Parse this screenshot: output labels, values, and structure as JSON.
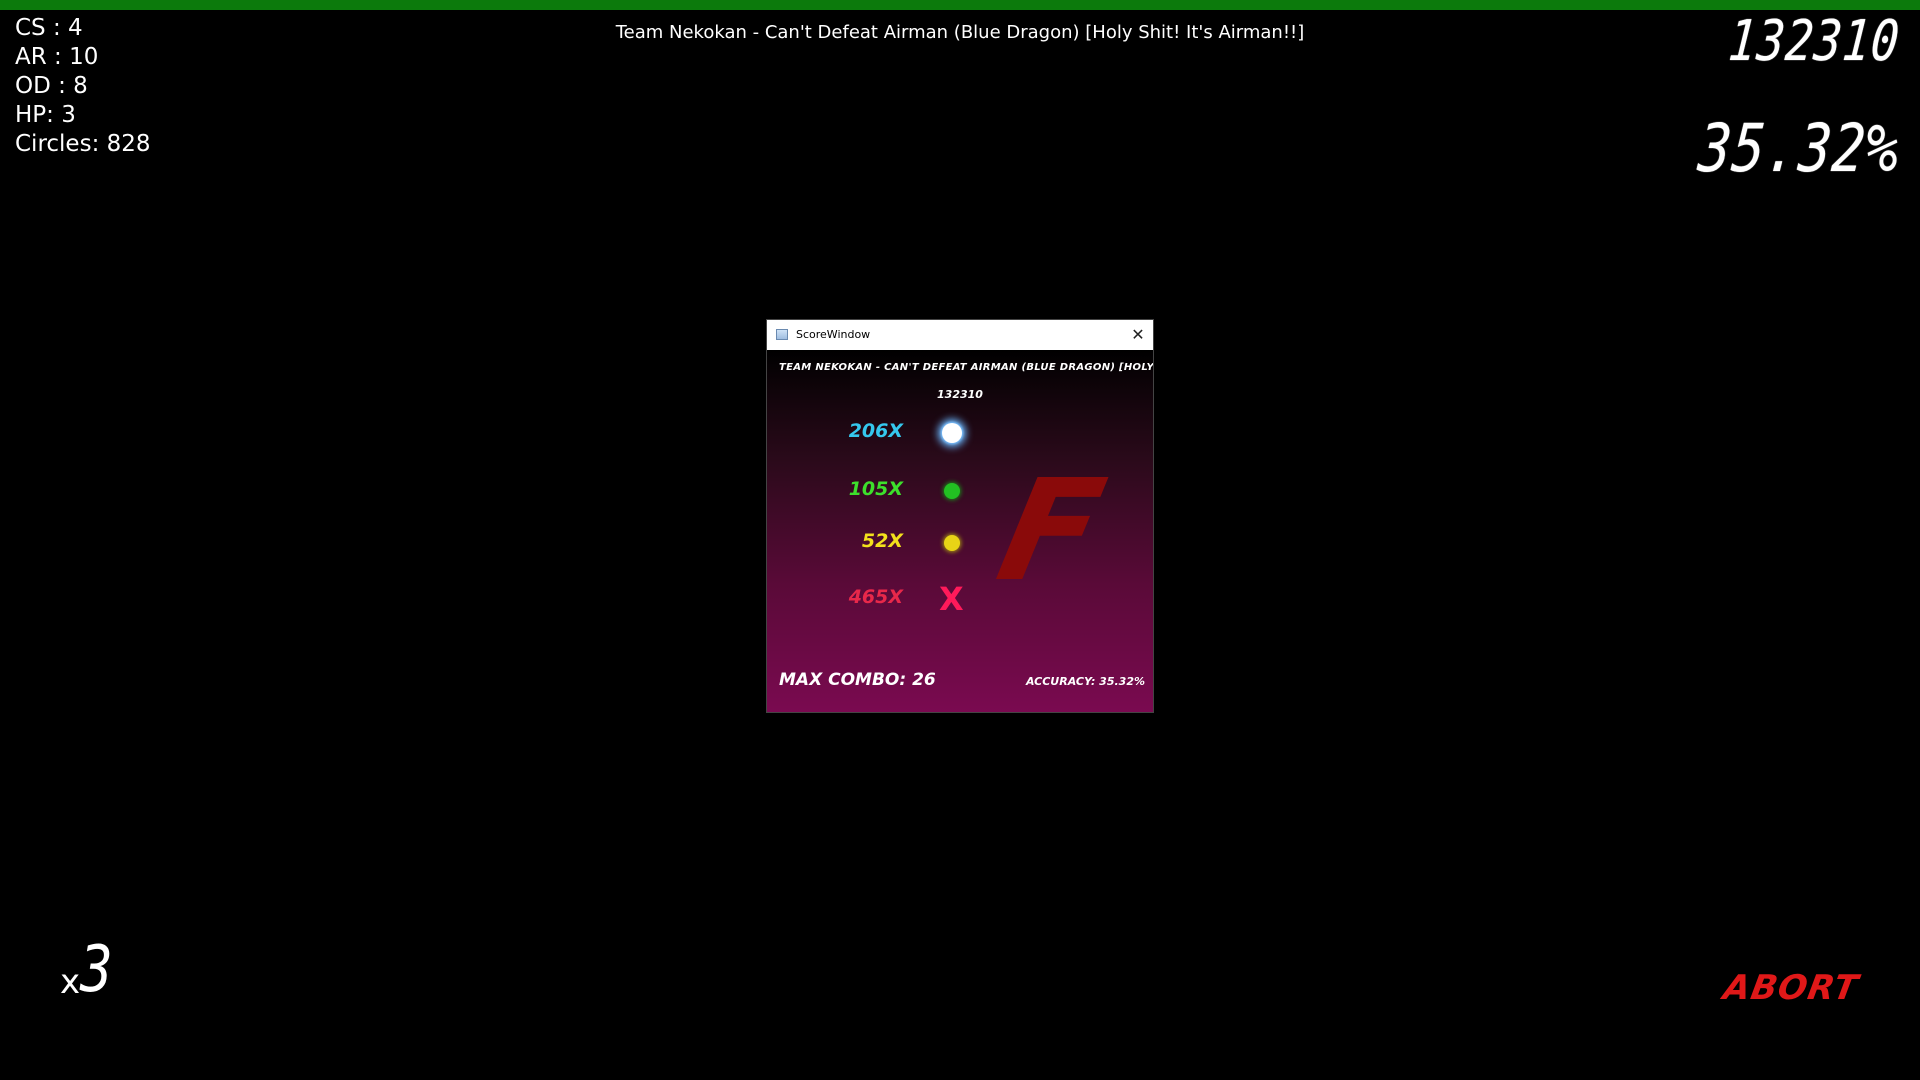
{
  "hud": {
    "hp_fill_fraction": 1.0,
    "stats": {
      "cs": "CS : 4",
      "ar": "AR : 10",
      "od": "OD : 8",
      "hp": "HP: 3",
      "circles": "Circles: 828"
    },
    "map_title": "Team Nekokan - Can't Defeat Airman (Blue Dragon) [Holy Shit! It's Airman!!]",
    "score": "132310",
    "accuracy": "35.32%",
    "multiplier_prefix": "x",
    "multiplier_value": "3",
    "abort_label": "ABORT"
  },
  "score_window": {
    "window_title": "ScoreWindow",
    "close_glyph": "✕",
    "map_title": "TEAM NEKOKAN - CAN'T DEFEAT AIRMAN (BLUE DRAGON) [HOLY SHIT! IT'S AIRMAN!!]",
    "score": "132310",
    "hits": [
      {
        "count": "206X",
        "color": "#35c8ee",
        "icon": "glowing-white-circle-icon"
      },
      {
        "count": "105X",
        "color": "#3de02c",
        "icon": "green-circle-icon"
      },
      {
        "count": "52X",
        "color": "#f2e01c",
        "icon": "yellow-circle-icon"
      },
      {
        "count": "465X",
        "color": "#e8284a",
        "icon": "red-x-icon"
      }
    ],
    "grade": "F",
    "max_combo": "MAX COMBO: 26",
    "accuracy": "ACCURACY: 35.32%"
  },
  "colors": {
    "hp_bar": "#0c7a0c",
    "abort": "#e01818",
    "grade": "#8a0a0a"
  }
}
